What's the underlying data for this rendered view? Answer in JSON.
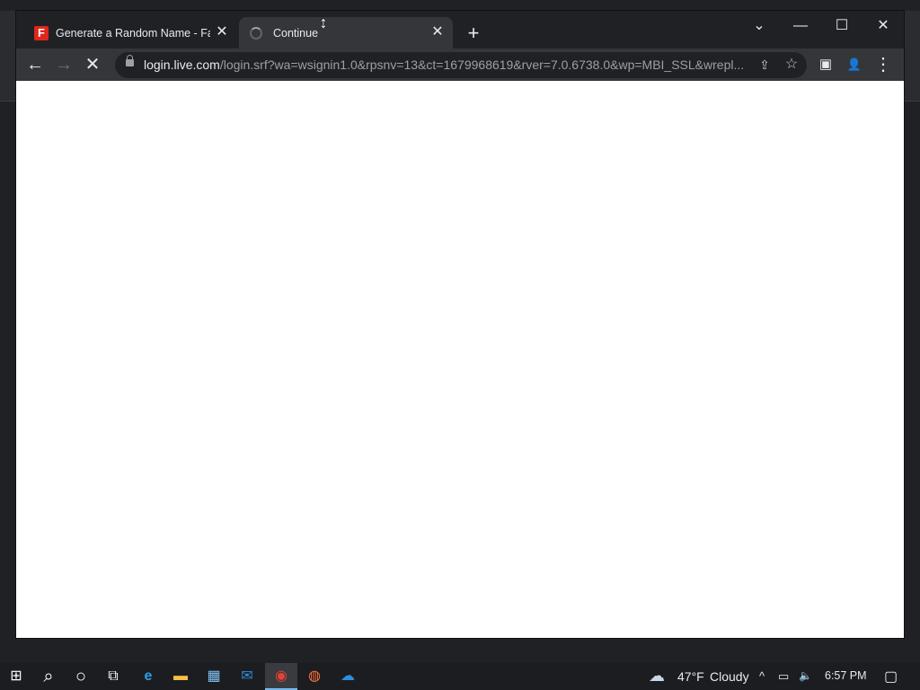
{
  "browser": {
    "tabs": [
      {
        "title": "Generate a Random Name - Fake",
        "favicon": "fakename-f-icon",
        "favicon_text": "F",
        "favicon_color": "#e1251b",
        "active": false
      },
      {
        "title": "Continue",
        "favicon": "loading-spinner-icon",
        "active": true
      }
    ],
    "new_tab_label": "+",
    "window_controls": {
      "dropdown": "⌄",
      "minimize": "—",
      "maximize": "☐",
      "close": "✕"
    },
    "toolbar": {
      "back": "←",
      "forward": "→",
      "stop": "✕",
      "url_host": "login.live.com",
      "url_path": "/login.srf?wa=wsignin1.0&rpsnv=13&ct=1679968619&rver=7.0.6738.0&wp=MBI_SSL&wrepl...",
      "share": "⇪",
      "bookmark": "☆",
      "side_panel": "▣",
      "profile": "👤",
      "menu": "⋮"
    }
  },
  "cursor": "↕",
  "taskbar": {
    "start": "⊞",
    "search": "⌕",
    "cortana": "○",
    "task_view": "⧉",
    "apps": [
      {
        "name": "edge-icon",
        "glyph": "e",
        "color": "#2aa0e6"
      },
      {
        "name": "file-explorer-icon",
        "glyph": "▬",
        "color": "#f5c045"
      },
      {
        "name": "store-icon",
        "glyph": "▦",
        "color": "#7ec3f0"
      },
      {
        "name": "mail-icon",
        "glyph": "✉",
        "color": "#2d8ee0"
      },
      {
        "name": "chrome-icon",
        "glyph": "◉",
        "color": "#e44134",
        "active": true
      },
      {
        "name": "firefox-icon",
        "glyph": "◍",
        "color": "#ff7139"
      },
      {
        "name": "onedrive-icon",
        "glyph": "☁",
        "color": "#2d8ee0"
      }
    ],
    "weather": {
      "temp": "47°F",
      "condition": "Cloudy"
    },
    "tray": {
      "chevron": "^",
      "network": "▭",
      "volume": "🔈"
    },
    "time": "6:57 PM",
    "notifications": "▢"
  }
}
